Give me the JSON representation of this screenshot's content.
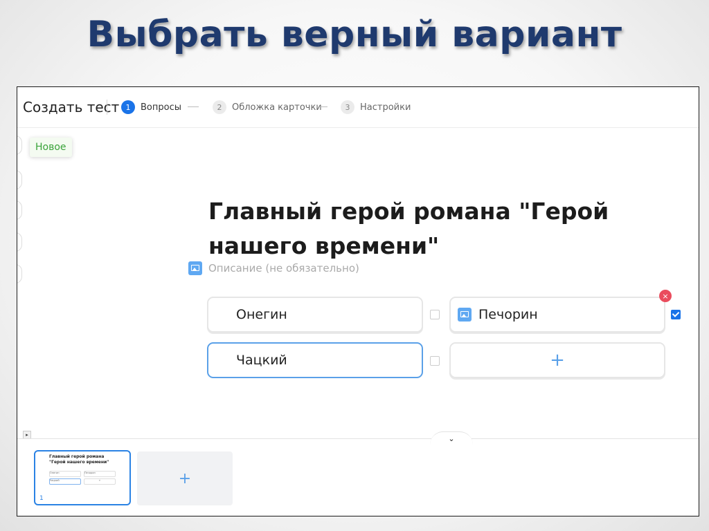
{
  "slide": {
    "title": "Выбрать верный вариант"
  },
  "header": {
    "app_title": "Создать тест",
    "steps": [
      {
        "num": "1",
        "label": "Вопросы"
      },
      {
        "num": "2",
        "label": "Обложка карточки"
      },
      {
        "num": "3",
        "label": "Настройки"
      }
    ]
  },
  "sidebar": {
    "new_tooltip": "Новое"
  },
  "question": {
    "text": "Главный герой романа \"Герой нашего времени\"",
    "description_placeholder": "Описание (не обязательно)"
  },
  "answers": [
    {
      "label": "Онегин",
      "correct": false
    },
    {
      "label": "Печорин",
      "correct": true
    },
    {
      "label": "Чацкий",
      "correct": false
    }
  ],
  "controls": {
    "add_answer": "+",
    "remove": "×",
    "collapse": "⌄",
    "scroll": "▸"
  },
  "slides_panel": {
    "slide_number": "1",
    "thumb_title": "Главный герой романа \"Герой нашего времени\"",
    "thumb_answers": [
      "Онегин",
      "Печорин",
      "Чацкий",
      "+"
    ],
    "add_slide": "+"
  },
  "colors": {
    "accent": "#1a73e8",
    "title": "#1f3a6e",
    "remove": "#ea4c5d",
    "tooltip": "#3aa33a"
  }
}
